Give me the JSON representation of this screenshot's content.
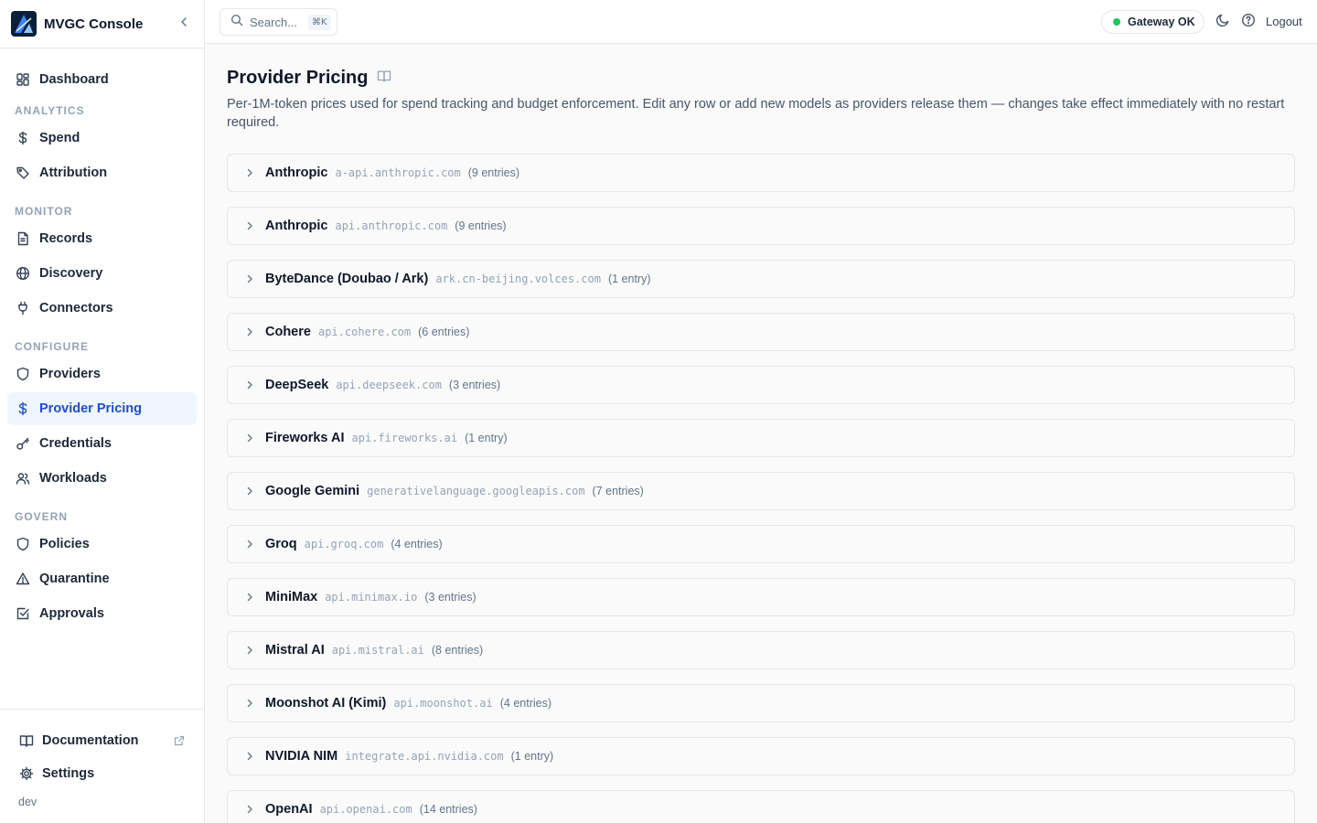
{
  "app": {
    "name": "MVGC Console",
    "env": "dev"
  },
  "sidebar": {
    "dashboard": "Dashboard",
    "sections": {
      "analytics": "ANALYTICS",
      "monitor": "MONITOR",
      "configure": "CONFIGURE",
      "govern": "GOVERN"
    },
    "items": {
      "spend": "Spend",
      "attribution": "Attribution",
      "records": "Records",
      "discovery": "Discovery",
      "connectors": "Connectors",
      "providers": "Providers",
      "provider_pricing": "Provider Pricing",
      "credentials": "Credentials",
      "workloads": "Workloads",
      "policies": "Policies",
      "quarantine": "Quarantine",
      "approvals": "Approvals"
    },
    "active_item": "Provider Pricing",
    "footer": {
      "documentation": "Documentation",
      "settings": "Settings"
    }
  },
  "topbar": {
    "search_placeholder": "Search...",
    "search_shortcut": "⌘K",
    "gateway_status": "Gateway OK",
    "gateway_color": "#22c55e",
    "logout": "Logout"
  },
  "page": {
    "title": "Provider Pricing",
    "description": "Per-1M-token prices used for spend tracking and budget enforcement. Edit any row or add new models as providers release them — changes take effect immediately with no restart required."
  },
  "provider_groups": [
    {
      "name": "Anthropic",
      "host": "a-api.anthropic.com",
      "count": "(9 entries)"
    },
    {
      "name": "Anthropic",
      "host": "api.anthropic.com",
      "count": "(9 entries)"
    },
    {
      "name": "ByteDance (Doubao / Ark)",
      "host": "ark.cn-beijing.volces.com",
      "count": "(1 entry)"
    },
    {
      "name": "Cohere",
      "host": "api.cohere.com",
      "count": "(6 entries)"
    },
    {
      "name": "DeepSeek",
      "host": "api.deepseek.com",
      "count": "(3 entries)"
    },
    {
      "name": "Fireworks AI",
      "host": "api.fireworks.ai",
      "count": "(1 entry)"
    },
    {
      "name": "Google Gemini",
      "host": "generativelanguage.googleapis.com",
      "count": "(7 entries)"
    },
    {
      "name": "Groq",
      "host": "api.groq.com",
      "count": "(4 entries)"
    },
    {
      "name": "MiniMax",
      "host": "api.minimax.io",
      "count": "(3 entries)"
    },
    {
      "name": "Mistral AI",
      "host": "api.mistral.ai",
      "count": "(8 entries)"
    },
    {
      "name": "Moonshot AI (Kimi)",
      "host": "api.moonshot.ai",
      "count": "(4 entries)"
    },
    {
      "name": "NVIDIA NIM",
      "host": "integrate.api.nvidia.com",
      "count": "(1 entry)"
    },
    {
      "name": "OpenAI",
      "host": "api.openai.com",
      "count": "(14 entries)"
    }
  ],
  "colors": {
    "accent": "#1d4ed8",
    "active_bg": "#eff6ff",
    "status_ok": "#22c55e"
  }
}
